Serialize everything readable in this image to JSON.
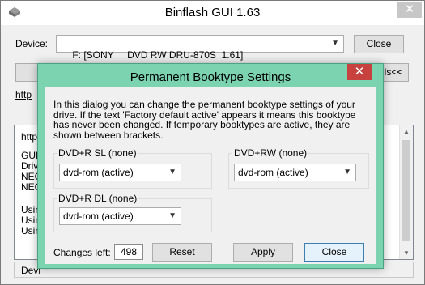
{
  "main": {
    "title": "Binflash GUI 1.63",
    "device_label": "Device:",
    "device_value": "F: [SONY     DVD RW DRU-870S  1.61]",
    "close_label": "Close",
    "url_fragment": "http",
    "tab_fragment": "ls<<",
    "log_lines": [
      "http:",
      "GUI",
      "Drive",
      "NEC",
      "NEC",
      "Using",
      "Using",
      "Using"
    ],
    "status_fragment": "Devi"
  },
  "dialog": {
    "title": "Permanent Booktype Settings",
    "intro": "In this dialog you can change the permanent booktype settings of your drive. If the text 'Factory default active' appears it means this booktype has never been changed. If temporary booktypes are active, they are shown between brackets.",
    "groups": {
      "plus_r_sl": {
        "label": "DVD+R SL (none)",
        "value": "dvd-rom (active)"
      },
      "plus_rw": {
        "label": "DVD+RW (none)",
        "value": "dvd-rom (active)"
      },
      "plus_r_dl": {
        "label": "DVD+R DL (none)",
        "value": "dvd-rom (active)"
      }
    },
    "changes_left_label": "Changes left:",
    "changes_left_value": "498",
    "reset_label": "Reset",
    "apply_label": "Apply",
    "close_label": "Close"
  }
}
